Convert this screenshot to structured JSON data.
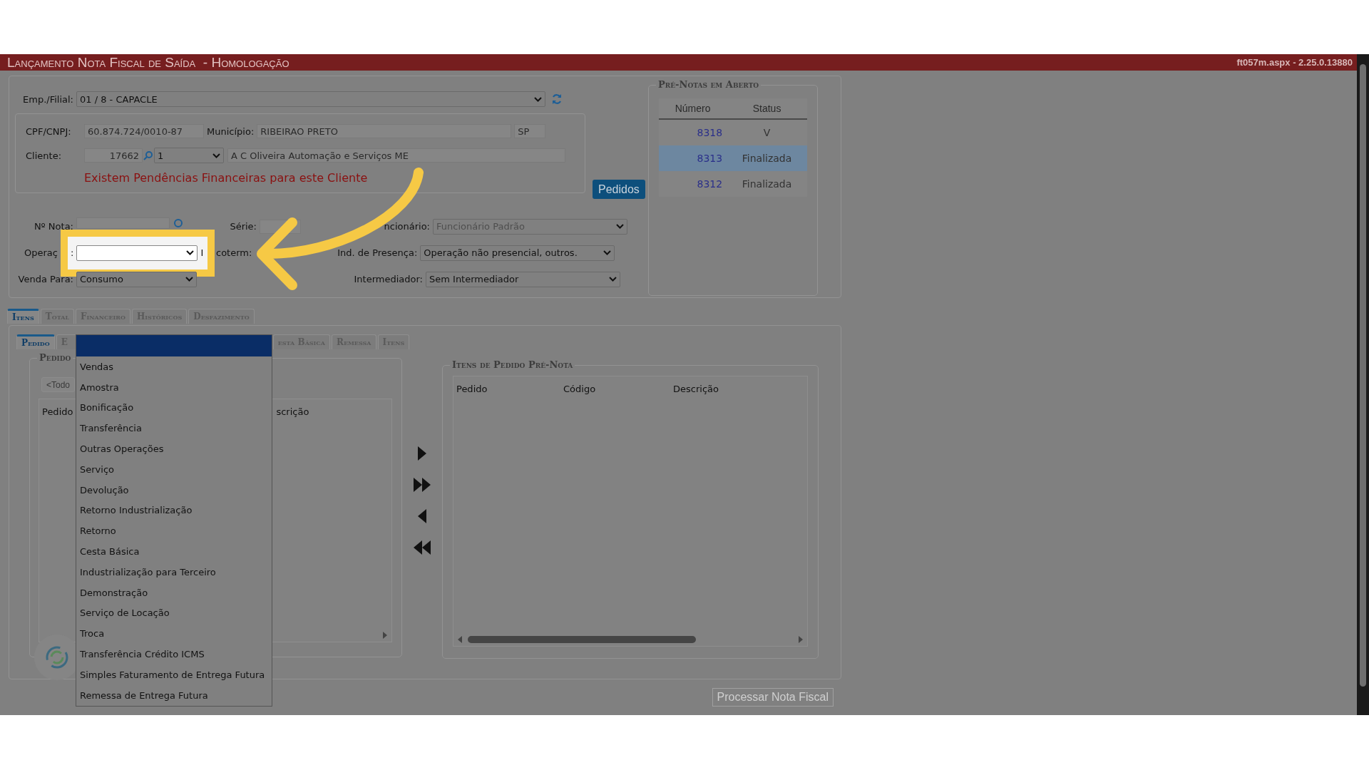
{
  "header": {
    "title": "Lançamento Nota Fiscal de Saída",
    "environment": "- Homologação",
    "version": "ft057m.aspx - 2.25.0.13880"
  },
  "emp_filial": {
    "label": "Emp./Filial:",
    "value": "01 / 8 - CAPACLE"
  },
  "cliente_box": {
    "cpf_label": "CPF/CNPJ:",
    "cpf": "60.874.724/0010-87",
    "municipio_label": "Município:",
    "municipio": "RIBEIRAO PRETO",
    "uf": "SP",
    "cliente_label": "Cliente:",
    "cliente_codigo": "17662",
    "loja": "1",
    "cliente_nome": "A C Oliveira Automação e Serviços ME",
    "warning": "Existem Pendências Financeiras para este Cliente"
  },
  "pedidos_button": "Pedidos",
  "nota_label": "Nº Nota:",
  "serie_label": "Série:",
  "funcionario": {
    "label": "ncionário:",
    "value": "Funcionário Padrão",
    "disabled": true
  },
  "operacao": {
    "label": "Operaç",
    "colon": ":",
    "incoterm_initial": "I",
    "incoterm_rest": "coterm:"
  },
  "presenca": {
    "label": "Ind. de Presença:",
    "value": "Operação não presencial, outros."
  },
  "venda_para": {
    "label": "Venda Para:",
    "value": "Consumo"
  },
  "intermediador": {
    "label": "Intermediador:",
    "value": "Sem Intermediador"
  },
  "pre_notas": {
    "title": "Pré-Notas em Aberto",
    "columns": [
      "Número",
      "Status"
    ],
    "rows": [
      {
        "numero": "8318",
        "status": "V",
        "selected": false
      },
      {
        "numero": "8313",
        "status": "Finalizada",
        "selected": true
      },
      {
        "numero": "8312",
        "status": "Finalizada",
        "selected": false
      }
    ]
  },
  "tabs": [
    {
      "label": "Itens",
      "selected": true
    },
    {
      "label": "Total",
      "selected": false
    },
    {
      "label": "Financeiro",
      "selected": false
    },
    {
      "label": "Históricos",
      "selected": false
    },
    {
      "label": "Desfazimento",
      "selected": false
    }
  ],
  "subtabs": [
    {
      "label": "Pedido",
      "selected": true
    },
    {
      "label": "E",
      "selected": false
    },
    {
      "label": "esta Básica",
      "selected": false
    },
    {
      "label": "Remessa",
      "selected": false
    },
    {
      "label": "Itens",
      "selected": false
    }
  ],
  "pedidos_panel": {
    "legend": "Pedido",
    "filter_button": "<Todo",
    "columns": [
      "Pedido",
      "scrição"
    ]
  },
  "transfer_buttons": [
    {
      "kind": "one-right"
    },
    {
      "kind": "all-right"
    },
    {
      "kind": "one-left"
    },
    {
      "kind": "all-left"
    }
  ],
  "itens_panel": {
    "legend": "Itens de Pedido Pré-Nota",
    "columns": [
      "Pedido",
      "Código",
      "Descrição"
    ]
  },
  "process_button": {
    "label": "Processar Nota Fiscal",
    "disabled": true
  },
  "operacao_dropdown": {
    "blank_highlighted": true,
    "options": [
      "Vendas",
      "Amostra",
      "Bonificação",
      "Transferência",
      "Outras Operações",
      "Serviço",
      "Devolução",
      "Retorno Industrialização",
      "Retorno",
      "Cesta Básica",
      "Industrialização para Terceiro",
      "Demonstração",
      "Serviço de Locação",
      "Troca",
      "Transferência Crédito ICMS",
      "Simples Faturamento de Entrega Futura",
      "Remessa de Entrega Futura"
    ]
  }
}
